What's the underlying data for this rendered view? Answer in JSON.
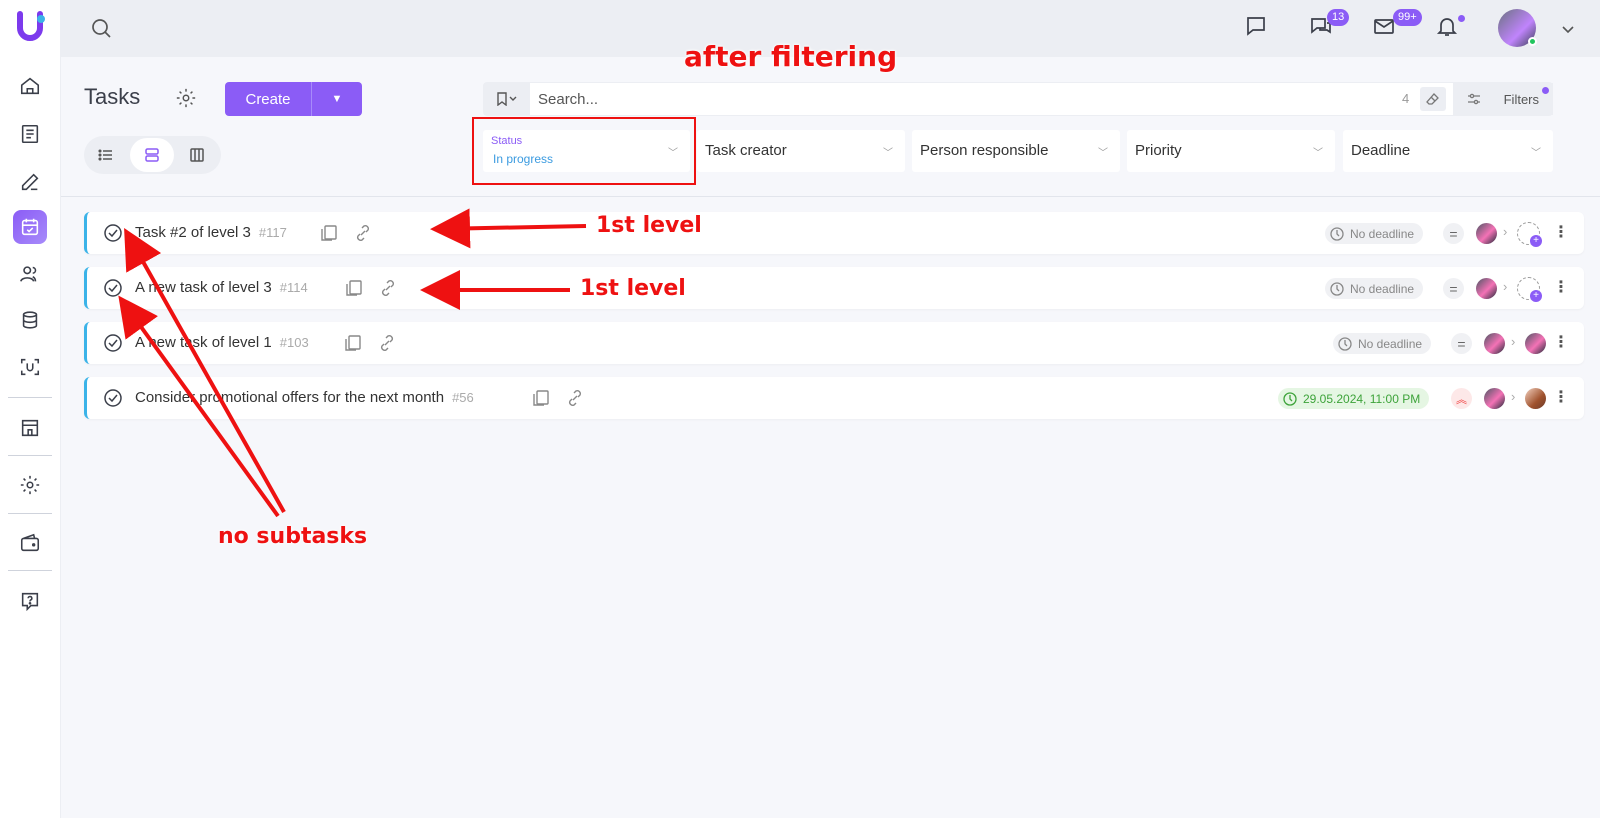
{
  "app": {
    "logo": "U",
    "brand_color": "#8b5cf6"
  },
  "topbar": {
    "chat_badge": "13",
    "mail_badge": "99+"
  },
  "header": {
    "title": "Tasks",
    "create_label": "Create"
  },
  "search": {
    "placeholder": "Search...",
    "count": "4",
    "filters_label": "Filters"
  },
  "filters": {
    "status_label": "Status",
    "status_value": "In progress",
    "task_creator": "Task creator",
    "person_responsible": "Person responsible",
    "priority": "Priority",
    "deadline": "Deadline"
  },
  "tasks": [
    {
      "name": "Task #2 of level 3",
      "num": "#117",
      "deadline": "No deadline",
      "priority": "normal"
    },
    {
      "name": "A new task of level 3",
      "num": "#114",
      "deadline": "No deadline",
      "priority": "normal"
    },
    {
      "name": "A new task of level 1",
      "num": "#103",
      "deadline": "No deadline",
      "priority": "normal"
    },
    {
      "name": "Consider promotional offers for the next month",
      "num": "#56",
      "deadline": "29.05.2024, 11:00 PM",
      "priority": "high"
    }
  ],
  "annotations": {
    "after_filtering": "after filtering",
    "first_level_1": "1st level",
    "first_level_2": "1st level",
    "no_subtasks": "no subtasks"
  },
  "colors": {
    "accent": "#8b5cf6",
    "task_border": "#3bb3e8",
    "annotation": "#ee1111",
    "deadline_green": "#3da33a"
  }
}
